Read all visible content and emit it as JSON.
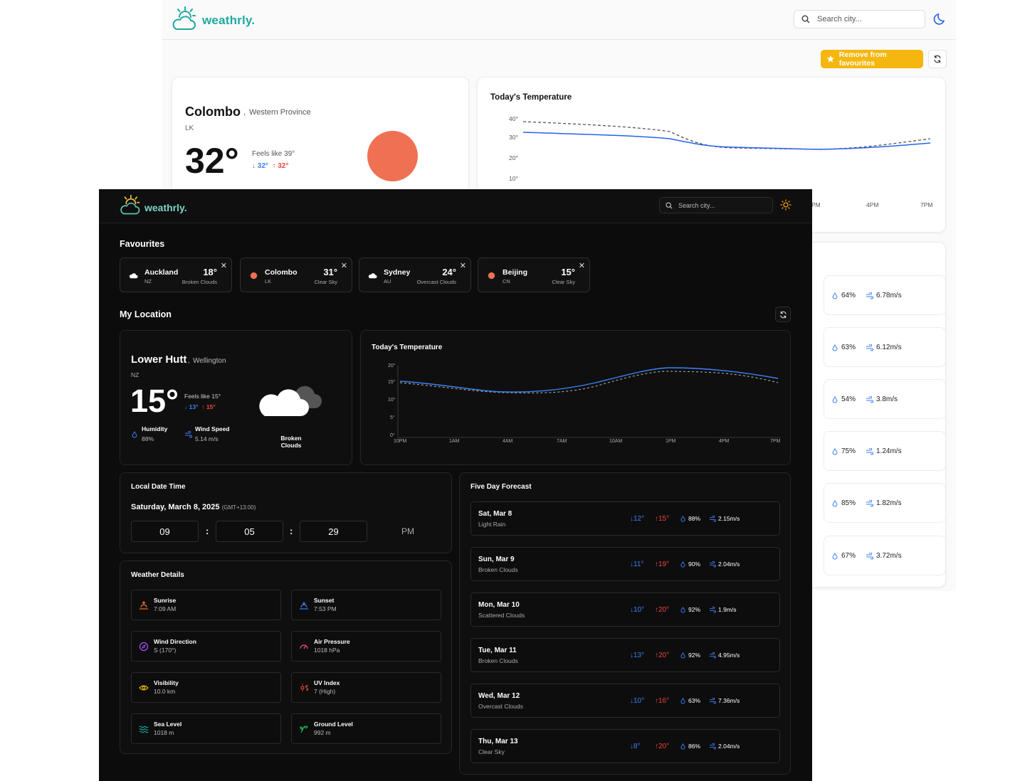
{
  "light": {
    "logo_text": "weathrly.",
    "search_placeholder": "Search city...",
    "theme_icon": "moon-icon",
    "favourite_button_label": "Remove from favourites",
    "location": {
      "city": "Colombo",
      "region": "Western Province",
      "country": "LK",
      "temp": "32°",
      "feels_like": "Feels like 39°",
      "min": "↓ 32°",
      "max": "↑ 32°"
    },
    "chart": {
      "title": "Today's Temperature",
      "y_ticks": [
        "40°",
        "30°",
        "20°",
        "10°"
      ],
      "x_ticks": [
        "PM",
        "4PM",
        "7PM"
      ]
    },
    "forecast_rows": [
      {
        "humidity": "64%",
        "wind": "6.78m/s"
      },
      {
        "humidity": "63%",
        "wind": "6.12m/s"
      },
      {
        "humidity": "54%",
        "wind": "3.8m/s"
      },
      {
        "humidity": "75%",
        "wind": "1.24m/s"
      },
      {
        "humidity": "85%",
        "wind": "1.82m/s"
      },
      {
        "humidity": "67%",
        "wind": "3.72m/s"
      }
    ]
  },
  "dark": {
    "logo_text": "weathrly.",
    "search_placeholder": "Search city...",
    "theme_icon": "sun-icon",
    "favourites_title": "Favourites",
    "favourites": [
      {
        "city": "Auckland",
        "country": "NZ",
        "temp": "18°",
        "desc": "Broken Clouds",
        "icon": "cloud-icon"
      },
      {
        "city": "Colombo",
        "country": "LK",
        "temp": "31°",
        "desc": "Clear Sky",
        "icon": "sun-dot-icon"
      },
      {
        "city": "Sydney",
        "country": "AU",
        "temp": "24°",
        "desc": "Overcast Clouds",
        "icon": "cloud-icon"
      },
      {
        "city": "Beijing",
        "country": "CN",
        "temp": "15°",
        "desc": "Clear Sky",
        "icon": "sun-dot-icon"
      }
    ],
    "my_location_title": "My Location",
    "location": {
      "city": "Lower Hutt",
      "region": "Wellington",
      "country": "NZ",
      "temp": "15°",
      "feels_like": "Feels like 15°",
      "min": "↓ 13°",
      "max": "↑ 15°",
      "humidity_label": "Humidity",
      "humidity_value": "88%",
      "wind_label": "Wind Speed",
      "wind_value": "5.14 m/s",
      "condition": "Broken Clouds"
    },
    "chart": {
      "title": "Today's Temperature",
      "y_ticks": [
        "20°",
        "15°",
        "10°",
        "5°",
        "0°"
      ],
      "x_ticks": [
        "10PM",
        "1AM",
        "4AM",
        "7AM",
        "10AM",
        "1PM",
        "4PM",
        "7PM"
      ]
    },
    "datetime": {
      "title": "Local Date Time",
      "date": "Saturday, March 8, 2025",
      "tz": "(GMT+13:00)",
      "hours": "09",
      "minutes": "05",
      "seconds": "29",
      "sep": ":",
      "ampm": "PM"
    },
    "details": {
      "title": "Weather Details",
      "items": [
        {
          "label": "Sunrise",
          "value": "7:09 AM",
          "color": "#f97316"
        },
        {
          "label": "Sunset",
          "value": "7:53 PM",
          "color": "#3b82f6"
        },
        {
          "label": "Wind Direction",
          "value": "S (170°)",
          "color": "#a855f7"
        },
        {
          "label": "Air Pressure",
          "value": "1018 hPa",
          "color": "#ec4899"
        },
        {
          "label": "Visibility",
          "value": "10.0 km",
          "color": "#eab308"
        },
        {
          "label": "UV Index",
          "value": "7 (High)",
          "color": "#ef4444"
        },
        {
          "label": "Sea Level",
          "value": "1018 m",
          "color": "#14b8a6"
        },
        {
          "label": "Ground Level",
          "value": "992 m",
          "color": "#22c55e"
        }
      ]
    },
    "forecast": {
      "title": "Five Day Forecast",
      "days": [
        {
          "day": "Sat, Mar 8",
          "desc": "Light Rain",
          "lo": "↓12°",
          "hi": "↑15°",
          "humidity": "88%",
          "wind": "2.15m/s"
        },
        {
          "day": "Sun, Mar 9",
          "desc": "Broken Clouds",
          "lo": "↓11°",
          "hi": "↑19°",
          "humidity": "90%",
          "wind": "2.04m/s"
        },
        {
          "day": "Mon, Mar 10",
          "desc": "Scattered Clouds",
          "lo": "↓10°",
          "hi": "↑20°",
          "humidity": "92%",
          "wind": "1.9m/s"
        },
        {
          "day": "Tue, Mar 11",
          "desc": "Broken Clouds",
          "lo": "↓13°",
          "hi": "↑20°",
          "humidity": "92%",
          "wind": "4.95m/s"
        },
        {
          "day": "Wed, Mar 12",
          "desc": "Overcast Clouds",
          "lo": "↓10°",
          "hi": "↑16°",
          "humidity": "63%",
          "wind": "7.36m/s"
        },
        {
          "day": "Thu, Mar 13",
          "desc": "Clear Sky",
          "lo": "↓8°",
          "hi": "↑20°",
          "humidity": "86%",
          "wind": "2.04m/s"
        }
      ]
    }
  },
  "colors": {
    "accent_teal": "#1fa9a0",
    "favourite_yellow": "#f5b70f",
    "sun_orange": "#f07053",
    "line_blue": "#3b82f6",
    "max_red": "#ef4444"
  }
}
